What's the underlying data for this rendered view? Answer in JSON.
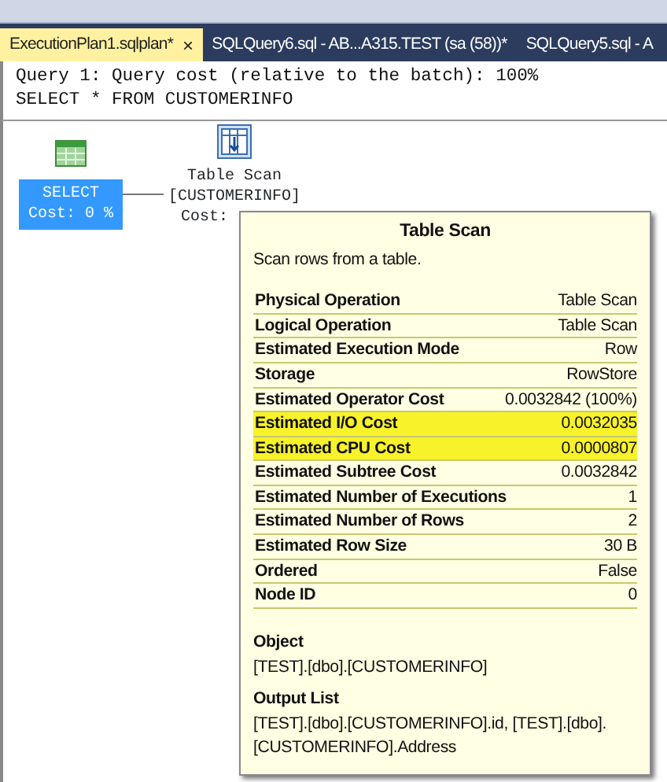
{
  "tabs": [
    {
      "label": "ExecutionPlan1.sqlplan*",
      "selected": true,
      "close": "×"
    },
    {
      "label": "SQLQuery6.sql - AB...A315.TEST (sa (58))*",
      "selected": false
    },
    {
      "label": "SQLQuery5.sql - A",
      "selected": false
    }
  ],
  "query_header": [
    "Query 1: Query cost (relative to the batch): 100%",
    "SELECT * FROM CUSTOMERINFO"
  ],
  "plan_nodes": [
    {
      "kind": "select",
      "lines": [
        "SELECT",
        "Cost: 0 %"
      ],
      "selected": true
    },
    {
      "kind": "table_scan",
      "lines": [
        "Table Scan",
        "[CUSTOMERINFO]",
        "Cost:"
      ],
      "selected": false
    }
  ],
  "tooltip": {
    "title": "Table Scan",
    "description": "Scan rows from a table.",
    "properties": [
      {
        "name": "Physical Operation",
        "value": "Table Scan",
        "highlighted": false
      },
      {
        "name": "Logical Operation",
        "value": "Table Scan",
        "highlighted": false
      },
      {
        "name": "Estimated Execution Mode",
        "value": "Row",
        "highlighted": false
      },
      {
        "name": "Storage",
        "value": "RowStore",
        "highlighted": false
      },
      {
        "name": "Estimated Operator Cost",
        "value": "0.0032842 (100%)",
        "highlighted": false
      },
      {
        "name": "Estimated I/O Cost",
        "value": "0.0032035",
        "highlighted": true
      },
      {
        "name": "Estimated CPU Cost",
        "value": "0.0000807",
        "highlighted": true
      },
      {
        "name": "Estimated Subtree Cost",
        "value": "0.0032842",
        "highlighted": false
      },
      {
        "name": "Estimated Number of Executions",
        "value": "1",
        "highlighted": false
      },
      {
        "name": "Estimated Number of Rows",
        "value": "2",
        "highlighted": false
      },
      {
        "name": "Estimated Row Size",
        "value": "30 B",
        "highlighted": false
      },
      {
        "name": "Ordered",
        "value": "False",
        "highlighted": false
      },
      {
        "name": "Node ID",
        "value": "0",
        "highlighted": false
      }
    ],
    "sections": [
      {
        "heading": "Object",
        "text": "[TEST].[dbo].[CUSTOMERINFO]"
      },
      {
        "heading": "Output List",
        "text": "[TEST].[dbo].[CUSTOMERINFO].id, [TEST].[dbo].[CUSTOMERINFO].Address"
      }
    ]
  }
}
